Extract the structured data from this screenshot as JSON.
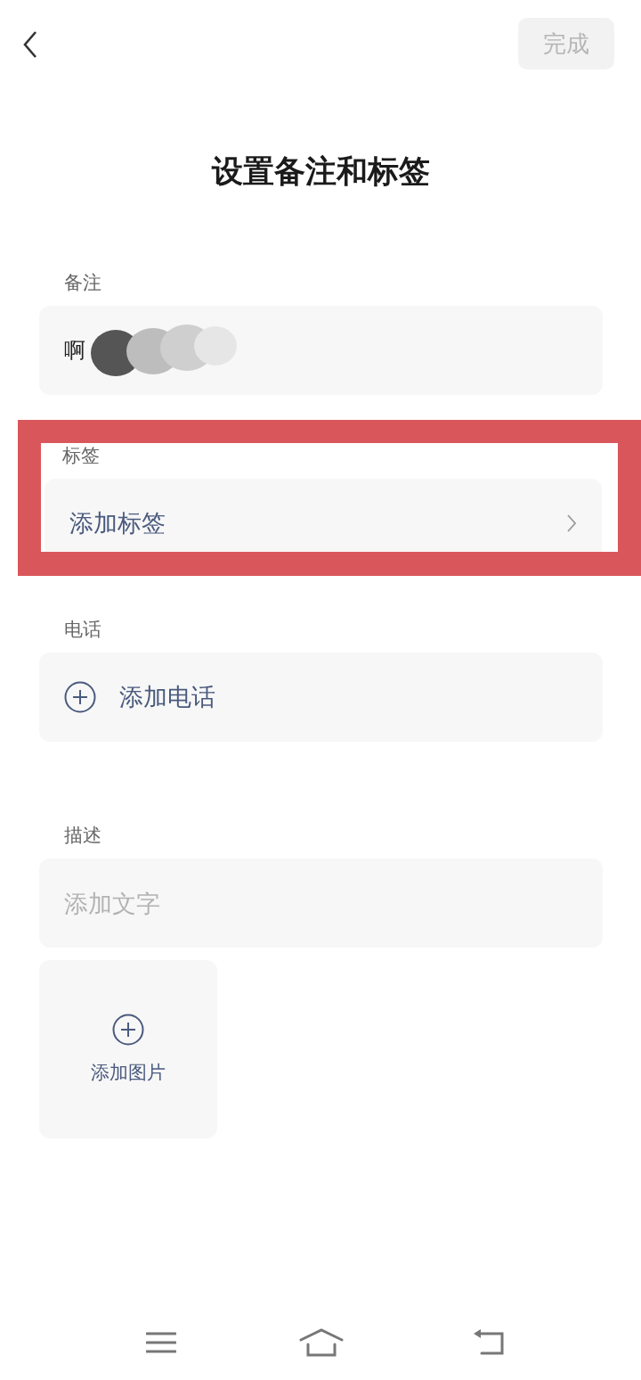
{
  "header": {
    "done_button": {
      "label": "完成",
      "disabled": true
    }
  },
  "title": "设置备注和标签",
  "sections": [
    {
      "kind": "text",
      "label": "备注",
      "value": "啊",
      "highlighted": false
    },
    {
      "kind": "link",
      "label": "标签",
      "action": "添加标签",
      "highlighted": true
    },
    {
      "kind": "add",
      "label": "电话",
      "action": "添加电话",
      "highlighted": false
    },
    {
      "kind": "textarea",
      "label": "描述",
      "placeholder": "添加文字",
      "image_action": "添加图片",
      "highlighted": false
    }
  ]
}
